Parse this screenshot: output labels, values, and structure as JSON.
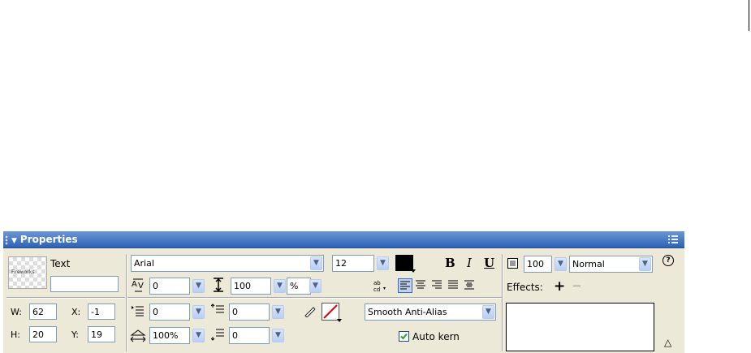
{
  "panel": {
    "title": "Properties",
    "collapse_glyph": "▼",
    "menu_icon": "panel-options-icon"
  },
  "object": {
    "kind": "Text",
    "preview_label": "Fireworks",
    "name_value": "",
    "w_label": "W:",
    "w_value": "62",
    "h_label": "H:",
    "h_value": "20",
    "x_label": "X:",
    "x_value": "-1",
    "y_label": "Y:",
    "y_value": "19"
  },
  "text": {
    "font": "Arial",
    "size": "12",
    "fill_color": "#000000",
    "bold": "B",
    "italic": "I",
    "underline": "U",
    "kerning": "0",
    "leading": "100",
    "leading_unit": "%",
    "indent": "0",
    "space_before": "0",
    "horizontal_scale": "100%",
    "space_after": "0",
    "anti_alias": "Smooth Anti-Alias",
    "auto_kern_label": "Auto kern",
    "auto_kern_checked": true,
    "stroke_color": "none"
  },
  "appearance": {
    "opacity": "100",
    "blend_mode": "Normal",
    "effects_label": "Effects:",
    "add_effect": "+",
    "remove_effect": "−",
    "help_glyph": "?",
    "expand_glyph": "△"
  }
}
